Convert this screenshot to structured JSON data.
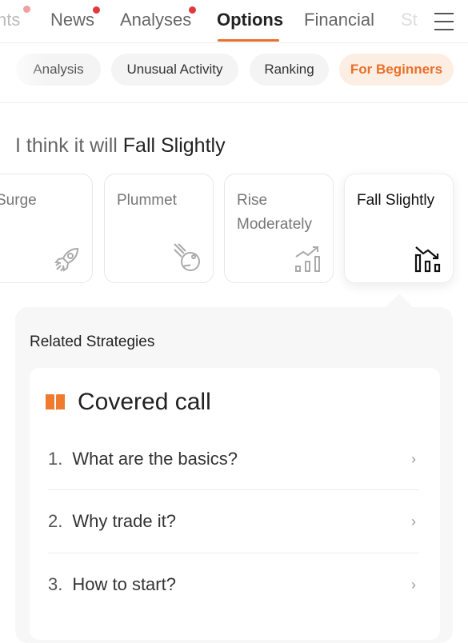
{
  "tabs": [
    {
      "label": "nts",
      "dot": true
    },
    {
      "label": "News",
      "dot": true
    },
    {
      "label": "Analyses",
      "dot": true
    },
    {
      "label": "Options",
      "active": true
    },
    {
      "label": "Financial"
    },
    {
      "label": "St"
    }
  ],
  "menu_icon": "hamburger-menu-icon",
  "pills": [
    {
      "label": "Analysis"
    },
    {
      "label": "Unusual Activity"
    },
    {
      "label": "Ranking"
    },
    {
      "label": "For Beginners",
      "active": true
    }
  ],
  "heading": {
    "prefix": "I think it will ",
    "choice": "Fall Slightly"
  },
  "cards": [
    {
      "label": "Surge",
      "icon": "rocket-icon"
    },
    {
      "label": "Plummet",
      "icon": "meteor-icon"
    },
    {
      "label": "Rise Moderately",
      "icon": "chart-rise-icon"
    },
    {
      "label": "Fall Slightly",
      "icon": "chart-fall-icon",
      "active": true
    }
  ],
  "related": {
    "label": "Related Strategies",
    "title": "Covered call",
    "title_icon": "book-icon",
    "items": [
      {
        "num": "1.",
        "text": "What are the basics?"
      },
      {
        "num": "2.",
        "text": "Why trade it?"
      },
      {
        "num": "3.",
        "text": "How to start?"
      }
    ]
  },
  "colors": {
    "accent": "#e8702a",
    "dot": "#e0393e"
  }
}
